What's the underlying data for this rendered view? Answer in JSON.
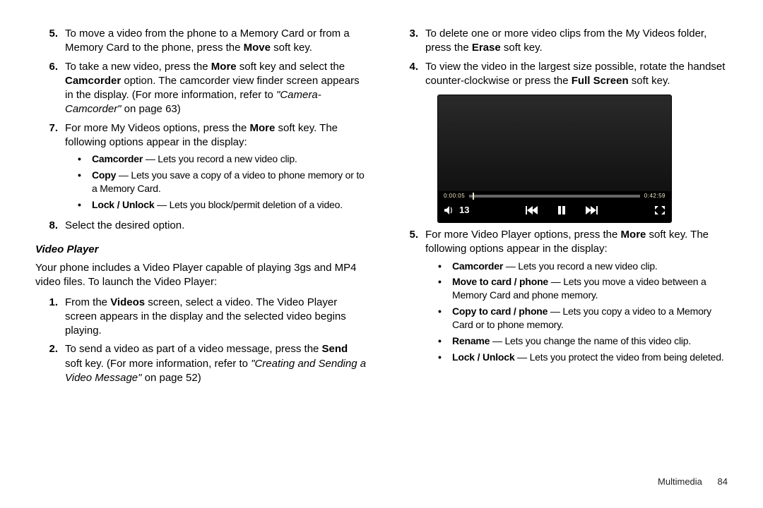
{
  "left": {
    "items": [
      {
        "num": "5.",
        "text_pre": "To move a video from the phone to a Memory Card or from a Memory Card to the phone, press the ",
        "bold1": "Move",
        "text_post": " soft key."
      },
      {
        "num": "6.",
        "text_pre": "To take a new video, press the ",
        "bold1": "More",
        "text_mid1": " soft key and select the ",
        "bold2": "Camcorder",
        "text_mid2": " option. The camcorder view finder screen appears in the display. (For more information, refer to ",
        "xref": "\"Camera-Camcorder\"",
        "xref_tail": " on page 63)"
      },
      {
        "num": "7.",
        "text_pre": "For more My Videos options, press the ",
        "bold1": "More",
        "text_post": " soft key. The following options appear in the display:",
        "bullets": [
          {
            "b": "Camcorder",
            "dash": " — Lets you record a new video clip."
          },
          {
            "b": "Copy",
            "dash": " — Lets you save a copy of a video to phone memory or to a Memory Card."
          },
          {
            "b": "Lock / Unlock",
            "dash": " — Lets you block/permit deletion of a video."
          }
        ]
      },
      {
        "num": "8.",
        "text_pre": "Select the desired option."
      }
    ],
    "subhead": "Video Player",
    "para": "Your phone includes a Video Player capable of playing 3gs and MP4 video files. To launch the Video Player:",
    "items2": [
      {
        "num": "1.",
        "text_pre": "From the ",
        "bold1": "Videos",
        "text_post": " screen, select a video. The Video Player screen appears in the display and the selected video begins playing."
      },
      {
        "num": "2.",
        "text_pre": "To send a video as part of a video message, press the ",
        "bold1": "Send",
        "text_mid1": " soft key. (For more information, refer to ",
        "xref": "\"Creating and Sending a Video Message\"",
        "xref_tail": " on page 52)"
      }
    ]
  },
  "right": {
    "items": [
      {
        "num": "3.",
        "text_pre": "To delete one or more video clips from the My Videos folder, press the ",
        "bold1": "Erase",
        "text_post": " soft key."
      },
      {
        "num": "4.",
        "text_pre": "To view the video in the largest size possible, rotate the handset counter-clockwise or press the ",
        "bold1": "Full Screen",
        "text_post": " soft key."
      }
    ],
    "player": {
      "time_left": "0:00:05",
      "time_right": "0:42:59",
      "volume": "13"
    },
    "items2": [
      {
        "num": "5.",
        "text_pre": "For more Video Player options, press the ",
        "bold1": "More",
        "text_post": " soft key. The following options appear in the display:",
        "bullets": [
          {
            "b": "Camcorder",
            "dash": " — Lets you record a new video clip."
          },
          {
            "b": "Move to card / phone",
            "dash": " — Lets you move a video between a Memory Card and phone memory."
          },
          {
            "b": "Copy to card / phone",
            "dash": " — Lets you copy a video to a Memory Card or to phone memory."
          },
          {
            "b": "Rename",
            "dash": " — Lets you change the name of this video clip."
          },
          {
            "b": "Lock / Unlock",
            "dash": " — Lets you protect the video from being deleted."
          }
        ]
      }
    ]
  },
  "footer": {
    "section": "Multimedia",
    "page": "84"
  }
}
